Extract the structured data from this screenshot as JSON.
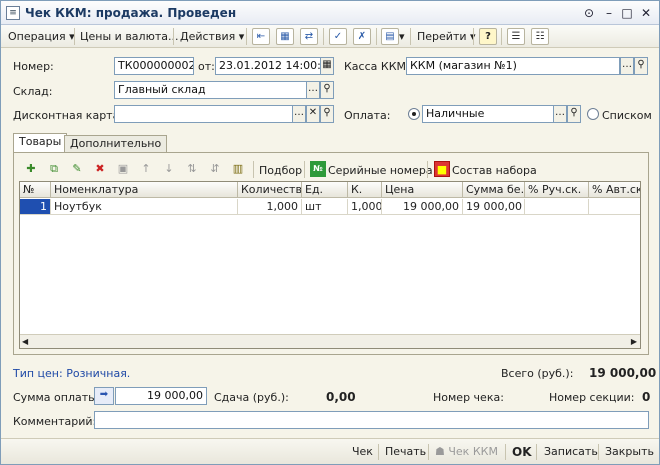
{
  "window": {
    "title": "Чек ККМ: продажа. Проведен"
  },
  "toolbar": {
    "operation": "Операция",
    "prices": "Цены и валюта...",
    "actions": "Действия",
    "goto": "Перейти",
    "help": "?"
  },
  "form": {
    "number_label": "Номер:",
    "number_value": "ТК000000002",
    "date_label": "от:",
    "date_value": "23.01.2012 14:00:00",
    "kkm_label": "Касса ККМ:",
    "kkm_value": "ККМ (магазин №1)",
    "warehouse_label": "Склад:",
    "warehouse_value": "Главный склад",
    "card_label": "Дисконтная карта:",
    "card_value": "",
    "payment_label": "Оплата:",
    "payment_value": "Наличные",
    "list_label": "Списком"
  },
  "tabs": [
    {
      "label": "Товары"
    },
    {
      "label": "Дополнительно"
    }
  ],
  "panel_toolbar": {
    "pick": "Подбор",
    "serials": "Серийные номера",
    "kit": "Состав набора",
    "serials_badge": "№"
  },
  "grid": {
    "columns": [
      "№",
      "Номенклатура",
      "Количество",
      "Ед.",
      "К.",
      "Цена",
      "Сумма бе...",
      "% Руч.ск.",
      "% Авт.ск."
    ],
    "rows": [
      {
        "n": "1",
        "item": "Ноутбук",
        "qty": "1,000",
        "unit": "шт",
        "k": "1,000",
        "price": "19 000,00",
        "sum": "19 000,00",
        "manual": "",
        "auto": ""
      }
    ]
  },
  "footer": {
    "price_type": "Тип цен: Розничная.",
    "total_label": "Всего (руб.):",
    "total_value": "19 000,00",
    "paid_label": "Сумма оплаты:",
    "paid_value": "19 000,00",
    "change_label": "Сдача (руб.):",
    "change_value": "0,00",
    "check_no_label": "Номер чека:",
    "section_no_label": "Номер секции:",
    "section_no_value": "0",
    "comment_label": "Комментарий:",
    "comment_value": ""
  },
  "buttons": {
    "check": "Чек",
    "print": "Печать",
    "check_kkm": "Чек ККМ",
    "ok": "OK",
    "save": "Записать",
    "close": "Закрыть"
  }
}
